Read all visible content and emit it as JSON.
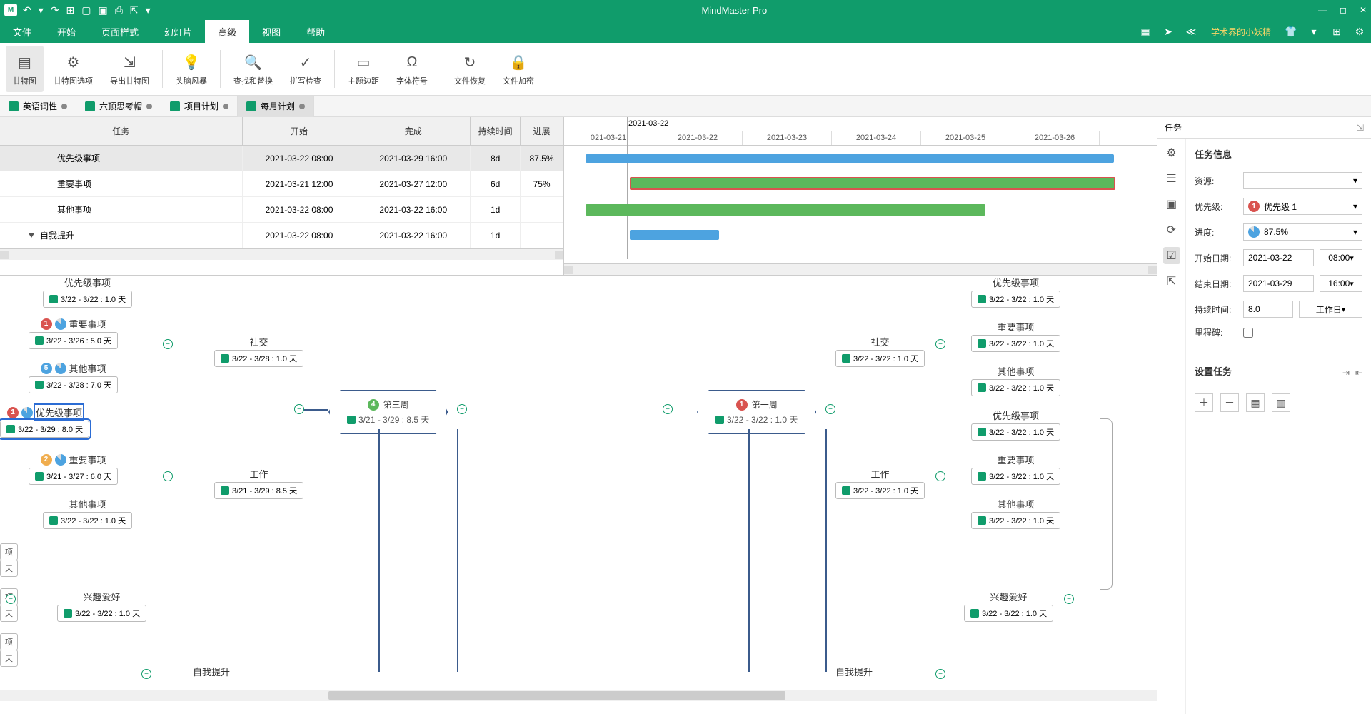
{
  "app": {
    "title": "MindMaster Pro"
  },
  "qat_icons": [
    "undo",
    "redo",
    "new",
    "open",
    "save",
    "print",
    "export"
  ],
  "win_icons": [
    "minimize",
    "maximize",
    "close"
  ],
  "menu": {
    "items": [
      "文件",
      "开始",
      "页面样式",
      "幻灯片",
      "高级",
      "视图",
      "帮助"
    ],
    "active": 4,
    "user": "学术界的小妖精"
  },
  "menu_ricons": [
    "grid",
    "send",
    "share",
    "shirt",
    "apps",
    "settings"
  ],
  "ribbon": [
    {
      "label": "甘特图",
      "icon": "▤",
      "active": true
    },
    {
      "label": "甘特图选项",
      "icon": "⚙"
    },
    {
      "label": "导出甘特图",
      "icon": "⇲"
    },
    {
      "sep": true
    },
    {
      "label": "头脑风暴",
      "icon": "💡"
    },
    {
      "sep": true
    },
    {
      "label": "查找和替换",
      "icon": "🔍"
    },
    {
      "label": "拼写检查",
      "icon": "✓"
    },
    {
      "sep": true
    },
    {
      "label": "主题边距",
      "icon": "▭"
    },
    {
      "label": "字体符号",
      "icon": "Ω"
    },
    {
      "sep": true
    },
    {
      "label": "文件恢复",
      "icon": "↻"
    },
    {
      "label": "文件加密",
      "icon": "🔒"
    }
  ],
  "doctabs": [
    {
      "label": "英语词性"
    },
    {
      "label": "六顶思考帽"
    },
    {
      "label": "项目计划"
    },
    {
      "label": "每月计划",
      "active": true
    }
  ],
  "gantt": {
    "headers": [
      "任务",
      "开始",
      "完成",
      "持续时间",
      "进展"
    ],
    "date_header": "2021-03-22",
    "date_cols": [
      "021-03-21",
      "2021-03-22",
      "2021-03-23",
      "2021-03-24",
      "2021-03-25",
      "2021-03-26"
    ],
    "rows": [
      {
        "task": "优先级事项",
        "start": "2021-03-22 08:00",
        "end": "2021-03-29 16:00",
        "dur": "8d",
        "prog": "87.5%",
        "sel": true
      },
      {
        "task": "重要事项",
        "start": "2021-03-21 12:00",
        "end": "2021-03-27 12:00",
        "dur": "6d",
        "prog": "75%"
      },
      {
        "task": "其他事项",
        "start": "2021-03-22 08:00",
        "end": "2021-03-22 16:00",
        "dur": "1d",
        "prog": ""
      },
      {
        "task": "自我提升",
        "start": "2021-03-22 08:00",
        "end": "2021-03-22 16:00",
        "dur": "1d",
        "prog": "",
        "exp": true
      }
    ]
  },
  "mind": {
    "week3": {
      "title": "第三周",
      "badge": "4",
      "date": "3/21 - 3/29 : 8.5 天"
    },
    "week1": {
      "title": "第一周",
      "badge": "1",
      "date": "3/22 - 3/22 : 1.0 天"
    },
    "left_group": [
      {
        "title": "优先级事项",
        "date": "3/22 - 3/22 : 1.0 天"
      },
      {
        "title": "重要事项",
        "date": "3/22 - 3/26 : 5.0 天",
        "badge": "1",
        "badgeColor": "r",
        "pie": true
      },
      {
        "title": "其他事项",
        "date": "3/22 - 3/28 : 7.0 天",
        "badge": "5",
        "badgeColor": "b",
        "pie": true
      },
      {
        "title": "优先级事项",
        "date": "3/22 - 3/29 : 8.0 天",
        "badge": "1",
        "badgeColor": "r",
        "pie": true,
        "sel": true
      },
      {
        "title": "重要事项",
        "date": "3/21 - 3/27 : 6.0 天",
        "badge": "2",
        "badgeColor": "o",
        "pie": true
      },
      {
        "title": "其他事项",
        "date": "3/22 - 3/22 : 1.0 天"
      }
    ],
    "left_branches": [
      {
        "title": "社交",
        "date": "3/22 - 3/28 : 1.0 天"
      },
      {
        "title": "工作",
        "date": "3/21 - 3/29 : 8.5 天"
      },
      {
        "title": "兴趣爱好",
        "date": "3/22 - 3/22 : 1.0 天"
      },
      {
        "title": "自我提升",
        "date": ""
      }
    ],
    "right_branches": [
      {
        "title": "社交",
        "date": "3/22 - 3/22 : 1.0 天"
      },
      {
        "title": "工作",
        "date": "3/22 - 3/22 : 1.0 天"
      },
      {
        "title": "兴趣爱好",
        "date": "3/22 - 3/22 : 1.0 天"
      },
      {
        "title": "自我提升",
        "date": ""
      }
    ],
    "right_group": [
      {
        "title": "优先级事项",
        "date": "3/22 - 3/22 : 1.0 天"
      },
      {
        "title": "重要事项",
        "date": "3/22 - 3/22 : 1.0 天"
      },
      {
        "title": "其他事项",
        "date": "3/22 - 3/22 : 1.0 天"
      },
      {
        "title": "优先级事项",
        "date": "3/22 - 3/22 : 1.0 天"
      },
      {
        "title": "重要事项",
        "date": "3/22 - 3/22 : 1.0 天"
      },
      {
        "title": "其他事项",
        "date": "3/22 - 3/22 : 1.0 天"
      }
    ],
    "frag_labels": [
      "项",
      "天",
      "项",
      "天",
      "项",
      "天"
    ]
  },
  "panel": {
    "title": "任务",
    "section1": "任务信息",
    "section2": "设置任务",
    "labels": {
      "resource": "资源:",
      "priority": "优先级:",
      "progress": "进度:",
      "start": "开始日期:",
      "end": "结束日期:",
      "duration": "持续时间:",
      "milestone": "里程碑:"
    },
    "values": {
      "priority": "优先级 1",
      "progress": "87.5%",
      "start_date": "2021-03-22",
      "start_time": "08:00",
      "end_date": "2021-03-29",
      "end_time": "16:00",
      "duration": "8.0",
      "dur_unit": "工作日"
    }
  }
}
